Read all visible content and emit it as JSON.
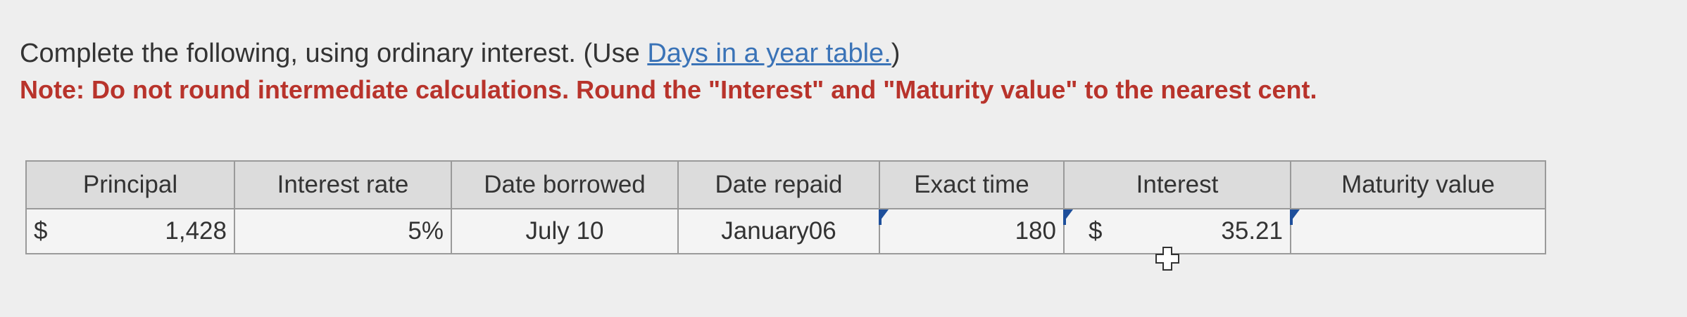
{
  "instructions": {
    "line1_prefix": "Complete the following, using ordinary interest. (Use ",
    "line1_link": "Days in a year table.",
    "line1_suffix": ")",
    "note": "Note: Do not round intermediate calculations. Round the \"Interest\" and \"Maturity value\" to the nearest cent."
  },
  "table": {
    "headers": [
      "Principal",
      "Interest rate",
      "Date borrowed",
      "Date repaid",
      "Exact time",
      "Interest",
      "Maturity value"
    ],
    "row": {
      "principal_currency": "$",
      "principal": "1,428",
      "interest_rate": "5%",
      "date_borrowed": "July 10",
      "date_repaid": "January06",
      "exact_time": "180",
      "interest_currency": "$",
      "interest": "35.21",
      "maturity_value": ""
    }
  },
  "colors": {
    "note": "#b8332b",
    "link": "#3a73b7",
    "input_border": "#3d5f8a"
  }
}
